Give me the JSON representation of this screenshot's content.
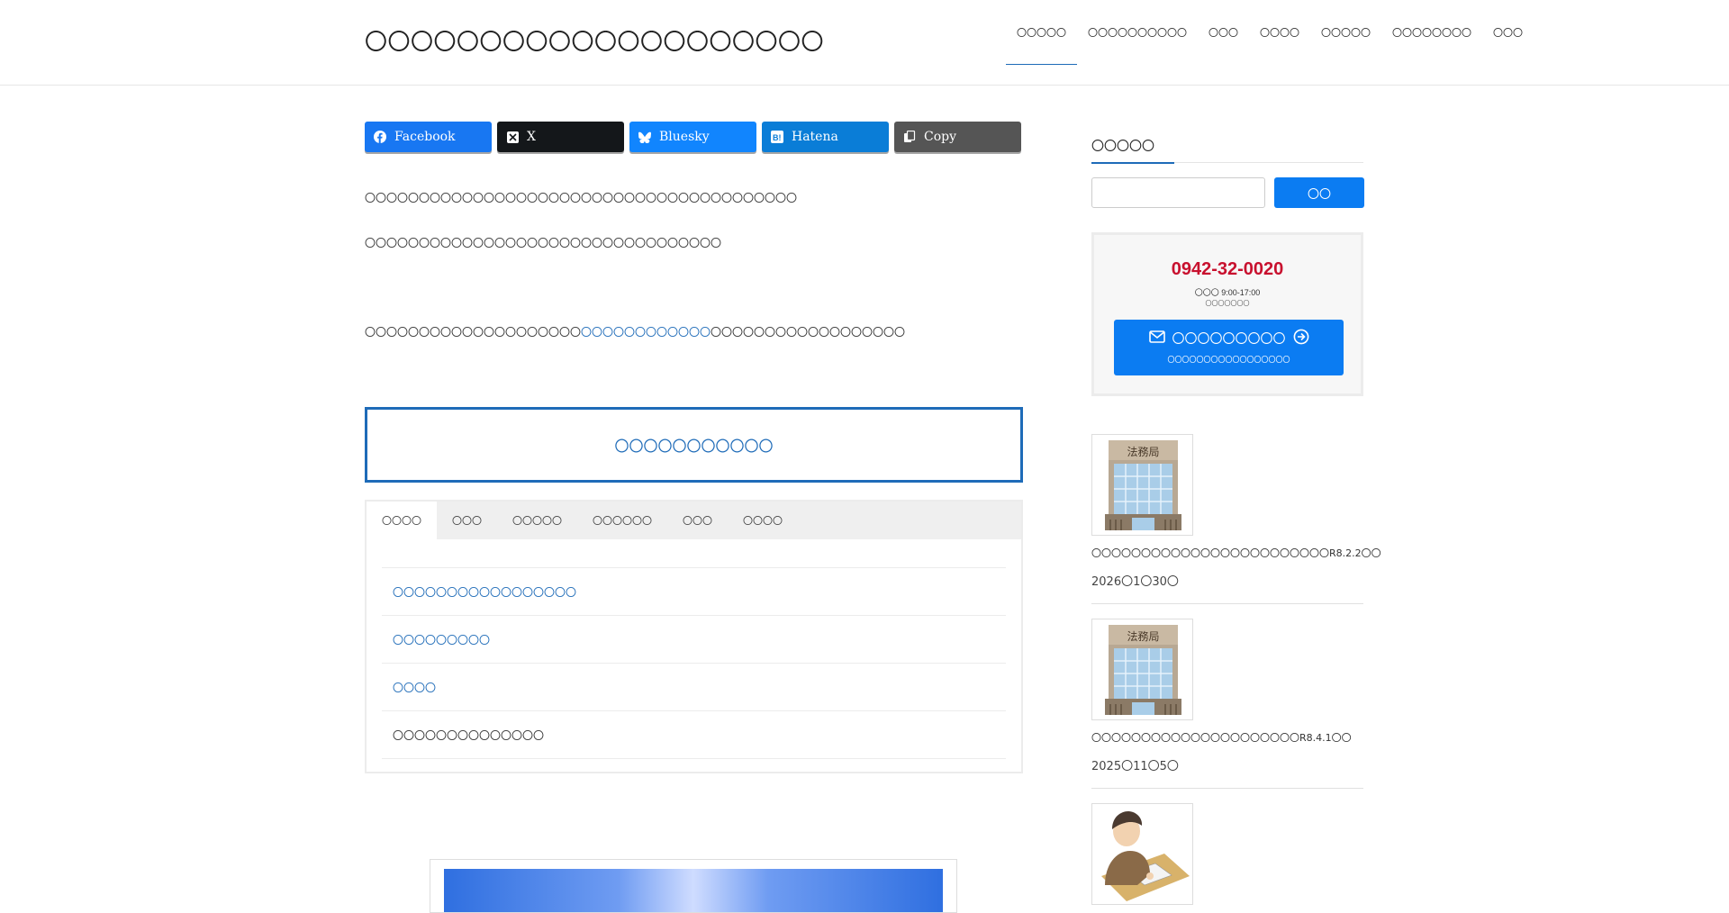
{
  "header": {
    "site_title": "〇〇〇〇〇〇〇〇〇〇〇〇〇〇〇〇〇〇〇〇",
    "nav": [
      {
        "label": "〇〇〇〇〇",
        "active": true
      },
      {
        "label": "〇〇〇〇〇〇〇〇〇〇"
      },
      {
        "label": "〇〇〇"
      },
      {
        "label": "〇〇〇〇"
      },
      {
        "label": "〇〇〇〇〇"
      },
      {
        "label": "〇〇〇〇〇〇〇〇"
      },
      {
        "label": "〇〇〇"
      }
    ]
  },
  "share": {
    "buttons": [
      {
        "label": "Facebook",
        "icon": "facebook-icon",
        "color": "#1877f2"
      },
      {
        "label": "X",
        "icon": "x-icon",
        "color": "#14171a"
      },
      {
        "label": "Bluesky",
        "icon": "bluesky-icon",
        "color": "#1185fe"
      },
      {
        "label": "Hatena",
        "icon": "hatena-icon",
        "color": "#0a7dd7"
      },
      {
        "label": "Copy",
        "icon": "copy-icon",
        "color": "#555555"
      }
    ]
  },
  "content": {
    "p1": "〇〇〇〇〇〇〇〇〇〇〇〇〇〇〇〇〇〇〇〇〇〇〇〇〇〇〇〇〇〇〇〇〇〇〇〇〇〇〇〇",
    "p2": "〇〇〇〇〇〇〇〇〇〇〇〇〇〇〇〇〇〇〇〇〇〇〇〇〇〇〇〇〇〇〇〇〇",
    "p3_before": "〇〇〇〇〇〇〇〇〇〇〇〇〇〇〇〇〇〇〇〇",
    "p3_link": "〇〇〇〇〇〇〇〇〇〇〇〇",
    "p3_after": "〇〇〇〇〇〇〇〇〇〇〇〇〇〇〇〇〇〇",
    "box_title": "〇〇〇〇〇〇〇〇〇〇〇"
  },
  "tabs": {
    "labels": [
      "〇〇〇〇",
      "〇〇〇",
      "〇〇〇〇〇",
      "〇〇〇〇〇〇",
      "〇〇〇",
      "〇〇〇〇"
    ],
    "active_index": 0,
    "rows": [
      {
        "label": "〇〇〇〇〇〇〇〇〇〇〇〇〇〇〇〇〇",
        "link": true
      },
      {
        "label": "〇〇〇〇〇〇〇〇〇",
        "link": true
      },
      {
        "label": "〇〇〇〇",
        "link": true
      },
      {
        "label": "〇〇〇〇〇〇〇〇〇〇〇〇〇〇",
        "link": false
      }
    ]
  },
  "sidebar": {
    "search_title": "〇〇〇〇〇",
    "search_placeholder": "",
    "search_button": "〇〇",
    "contact": {
      "phone": "0942-32-0020",
      "hours": "〇〇〇 9:00-17:00",
      "hours_note": "〇〇〇〇〇〇〇",
      "button_label": "〇〇〇〇〇〇〇〇〇",
      "button_sub": "〇〇〇〇〇〇〇〇〇〇〇〇〇〇〇〇〇"
    },
    "posts": [
      {
        "title": "〇〇〇〇〇〇〇〇〇〇〇〇〇〇〇〇〇〇〇〇〇〇〇〇R8.2.2〇〇",
        "date": "2026〇1〇30〇",
        "thumb_label": "法務局",
        "thumb_icon": "building-icon"
      },
      {
        "title": "〇〇〇〇〇〇〇〇〇〇〇〇〇〇〇〇〇〇〇〇〇R8.4.1〇〇",
        "date": "2025〇11〇5〇",
        "thumb_label": "法務局",
        "thumb_icon": "building-icon"
      },
      {
        "title": "",
        "date": "",
        "thumb_label": "",
        "thumb_icon": "person-writing-icon"
      }
    ]
  },
  "colors": {
    "accent": "#1e6bb8",
    "button_blue": "#0b7cf2",
    "phone_red": "#c8102e"
  }
}
